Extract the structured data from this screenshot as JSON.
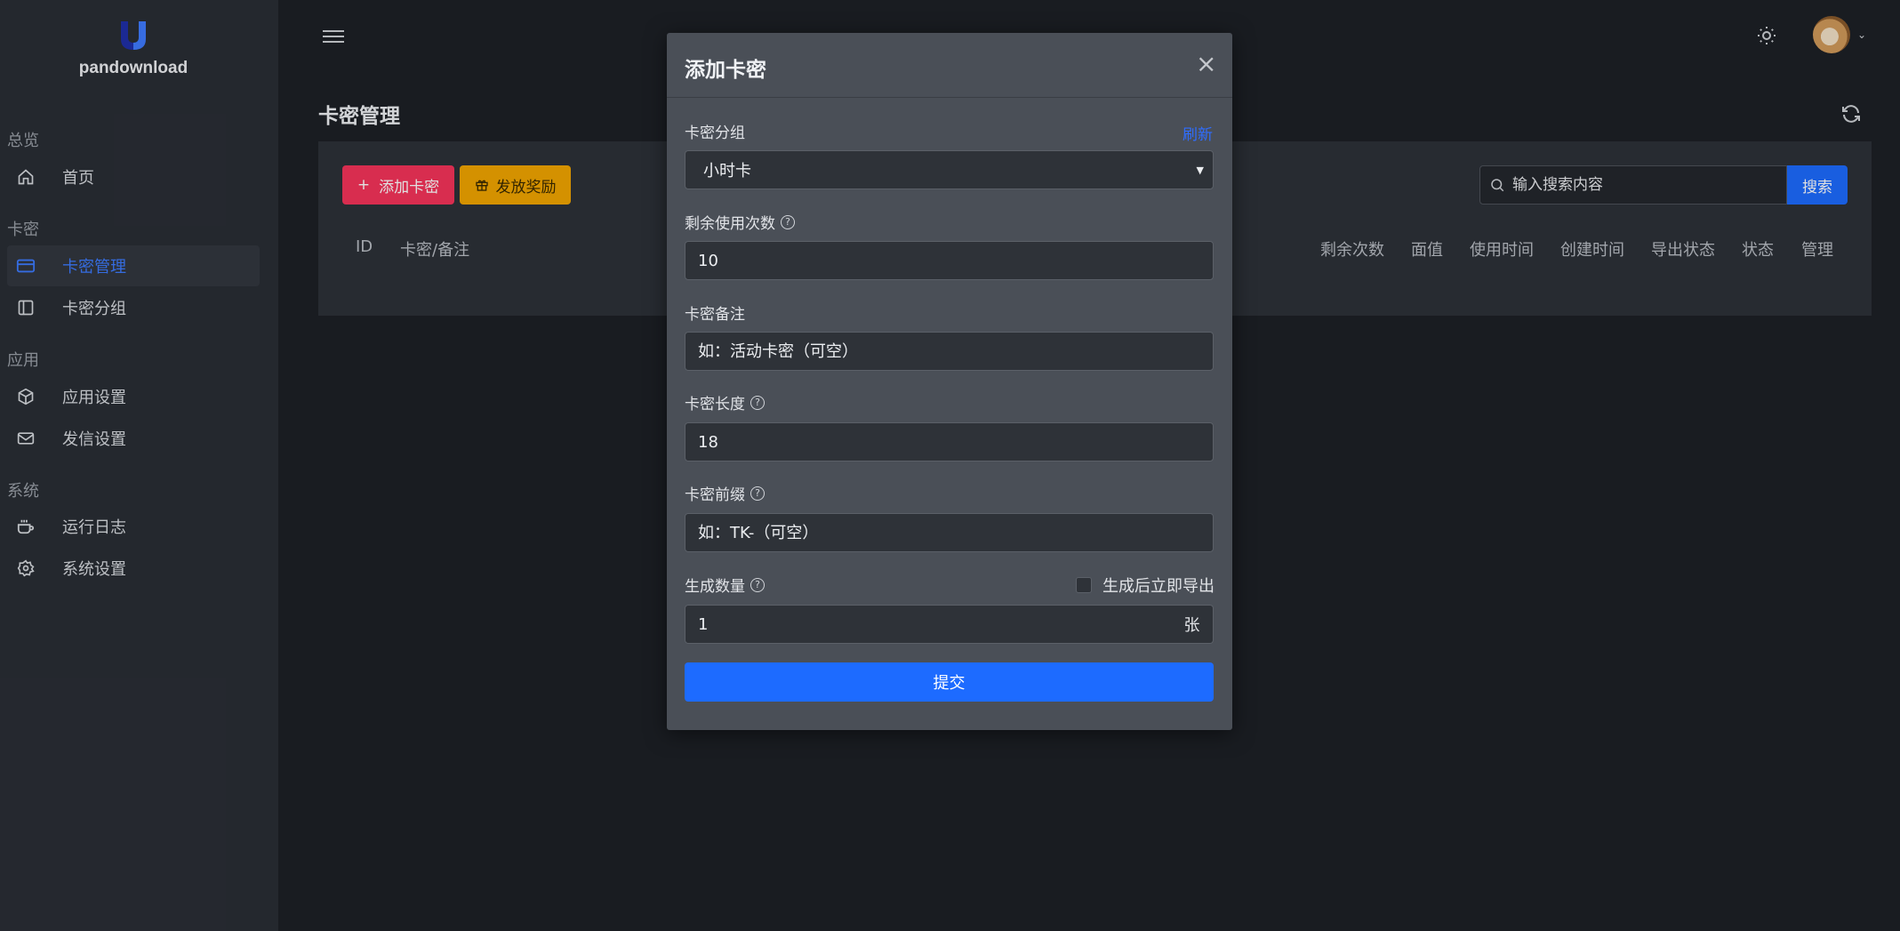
{
  "brand": {
    "name": "pandownload"
  },
  "sidebar": {
    "sections": [
      {
        "title": "总览",
        "items": [
          {
            "label": "首页",
            "icon": "home-icon"
          }
        ]
      },
      {
        "title": "卡密",
        "items": [
          {
            "label": "卡密管理",
            "icon": "card-icon",
            "active": true
          },
          {
            "label": "卡密分组",
            "icon": "sidebar-panel-icon"
          }
        ]
      },
      {
        "title": "应用",
        "items": [
          {
            "label": "应用设置",
            "icon": "cube-icon"
          },
          {
            "label": "发信设置",
            "icon": "mail-icon"
          }
        ]
      },
      {
        "title": "系统",
        "items": [
          {
            "label": "运行日志",
            "icon": "coffee-icon"
          },
          {
            "label": "系统设置",
            "icon": "gear-icon"
          }
        ]
      }
    ]
  },
  "page": {
    "title": "卡密管理",
    "add_button": "添加卡密",
    "reward_button": "发放奖励",
    "search_placeholder": "输入搜索内容",
    "search_button": "搜索",
    "table_headers": [
      "ID",
      "卡密/备注",
      "剩余次数",
      "面值",
      "使用时间",
      "创建时间",
      "导出状态",
      "状态",
      "管理"
    ]
  },
  "modal": {
    "title": "添加卡密",
    "group_label": "卡密分组",
    "refresh_link": "刷新",
    "group_value": "小时卡",
    "remaining_label": "剩余使用次数",
    "remaining_value": "10",
    "note_label": "卡密备注",
    "note_placeholder": "如：活动卡密（可空）",
    "length_label": "卡密长度",
    "length_value": "18",
    "prefix_label": "卡密前缀",
    "prefix_placeholder": "如：TK-（可空）",
    "count_label": "生成数量",
    "export_label": "生成后立即导出",
    "count_value": "1",
    "count_unit": "张",
    "submit_label": "提交"
  },
  "colors": {
    "accent": "#1d6bff",
    "danger": "#f6345b",
    "warning": "#f2a600",
    "link": "#2f6dff"
  }
}
